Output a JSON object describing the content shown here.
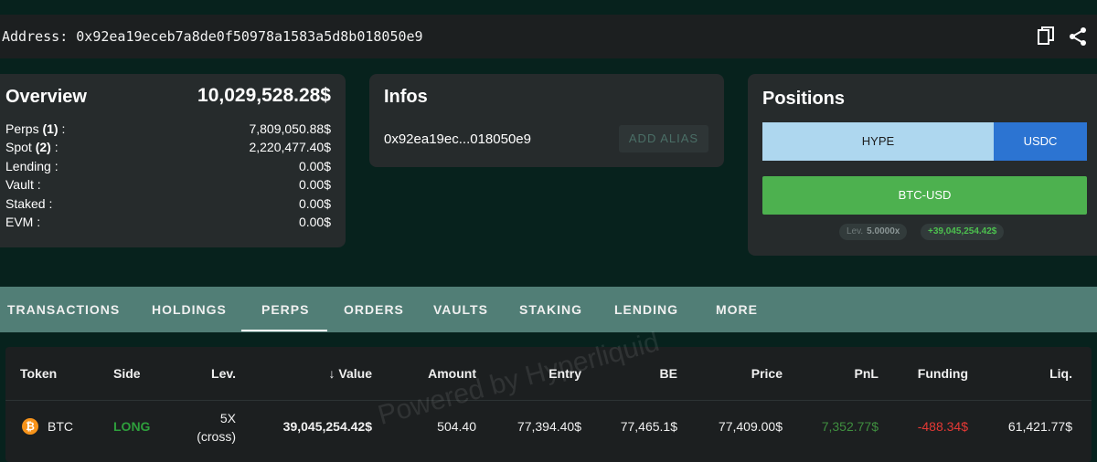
{
  "address_bar": {
    "label": "Address:",
    "address": "0x92ea19eceb7a8de0f50978a1583a5d8b018050e9",
    "copy_icon": "copy-icon",
    "share_icon": "share-icon"
  },
  "overview": {
    "title": "Overview",
    "total": "10,029,528.28$",
    "rows": [
      {
        "label": "Perps",
        "count": "(1)",
        "suffix": " :",
        "value": "7,809,050.88$"
      },
      {
        "label": "Spot",
        "count": "(2)",
        "suffix": " :",
        "value": "2,220,477.40$"
      },
      {
        "label": "Lending :",
        "count": "",
        "suffix": "",
        "value": "0.00$"
      },
      {
        "label": "Vault :",
        "count": "",
        "suffix": "",
        "value": "0.00$"
      },
      {
        "label": "Staked :",
        "count": "",
        "suffix": "",
        "value": "0.00$"
      },
      {
        "label": "EVM :",
        "count": "",
        "suffix": "",
        "value": "0.00$"
      }
    ]
  },
  "infos": {
    "title": "Infos",
    "short_address": "0x92ea19ec...018050e9",
    "add_alias_label": "ADD ALIAS"
  },
  "positions": {
    "title": "Positions",
    "spot_tokens": [
      {
        "label": "HYPE",
        "color": "#aed7ef"
      },
      {
        "label": "USDC",
        "color": "#2c74d2"
      }
    ],
    "perp_label": "BTC-USD",
    "perp_color": "#4db14f",
    "lev_label": "Lev.",
    "lev_value": "5.0000x",
    "pnl_value": "+39,045,254.42$"
  },
  "tabs": [
    {
      "label": "TRANSACTIONS",
      "active": false
    },
    {
      "label": "HOLDINGS",
      "active": false
    },
    {
      "label": "PERPS",
      "active": true
    },
    {
      "label": "ORDERS",
      "active": false
    },
    {
      "label": "VAULTS",
      "active": false
    },
    {
      "label": "STAKING",
      "active": false
    },
    {
      "label": "LENDING",
      "active": false
    },
    {
      "label": "MORE",
      "active": false
    }
  ],
  "table": {
    "headers": {
      "token": "Token",
      "side": "Side",
      "lev": "Lev.",
      "value_arrow": "↓",
      "value": "Value",
      "amount": "Amount",
      "entry": "Entry",
      "be": "BE",
      "price": "Price",
      "pnl": "PnL",
      "funding": "Funding",
      "liq": "Liq."
    },
    "rows": [
      {
        "token_icon": "bitcoin-icon",
        "token_icon_glyph": "₿",
        "token": "BTC",
        "side": "LONG",
        "lev": "5X",
        "lev_mode": "(cross)",
        "value": "39,045,254.42$",
        "amount": "504.40",
        "entry": "77,394.40$",
        "be": "77,465.1$",
        "price": "77,409.00$",
        "pnl": "7,352.77$",
        "funding": "-488.34$",
        "liq": "61,421.77$"
      }
    ]
  },
  "colors": {
    "background": "#07221d",
    "card": "#262b2c",
    "tab_bar": "#517e76",
    "long": "#2e9f3c",
    "pnl_positive": "#3f8f3f",
    "funding_negative": "#e53935"
  },
  "watermark": "Powered by Hyperliquid"
}
